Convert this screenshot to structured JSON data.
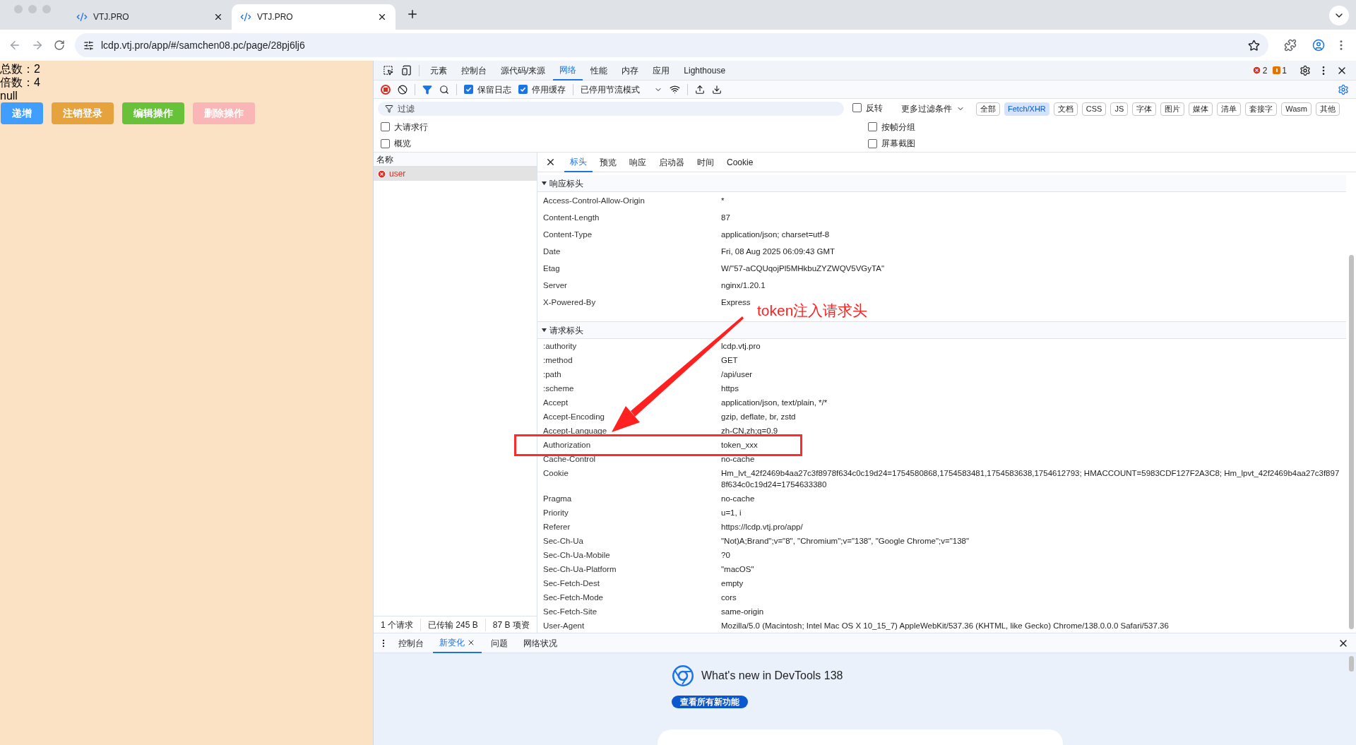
{
  "browser": {
    "tabs": [
      {
        "title": "VTJ.PRO",
        "selected": false
      },
      {
        "title": "VTJ.PRO",
        "selected": true
      }
    ],
    "url": "lcdp.vtj.pro/app/#/samchen08.pc/page/28pj6lj6"
  },
  "page": {
    "lines": [
      "总数：2",
      "倍数：4",
      "null"
    ],
    "buttons": [
      {
        "label": "递增",
        "color": "#409eff"
      },
      {
        "label": "注销登录",
        "color": "#e6a23c"
      },
      {
        "label": "编辑操作",
        "color": "#67c23a"
      },
      {
        "label": "删除操作",
        "color": "#fab6b6"
      }
    ]
  },
  "devtools": {
    "panel_tabs": [
      {
        "label": "元素",
        "selected": false
      },
      {
        "label": "控制台",
        "selected": false
      },
      {
        "label": "源代码/来源",
        "selected": false
      },
      {
        "label": "网络",
        "selected": true
      },
      {
        "label": "性能",
        "selected": false
      },
      {
        "label": "内存",
        "selected": false
      },
      {
        "label": "应用",
        "selected": false
      },
      {
        "label": "Lighthouse",
        "selected": false
      }
    ],
    "error_count": "2",
    "warning_count": "1",
    "toolbar": {
      "checkboxes": [
        {
          "label": "保留日志",
          "checked": true
        },
        {
          "label": "停用缓存",
          "checked": true
        }
      ],
      "throttling": "已停用节流模式"
    },
    "filter": {
      "placeholder": "过滤",
      "invert": {
        "label": "反转",
        "checked": false
      },
      "more_filters": "更多过滤条件",
      "types": [
        {
          "label": "全部",
          "selected": false
        },
        {
          "label": "Fetch/XHR",
          "selected": true
        },
        {
          "label": "文档",
          "selected": false
        },
        {
          "label": "CSS",
          "selected": false
        },
        {
          "label": "JS",
          "selected": false
        },
        {
          "label": "字体",
          "selected": false
        },
        {
          "label": "图片",
          "selected": false
        },
        {
          "label": "媒体",
          "selected": false
        },
        {
          "label": "清单",
          "selected": false
        },
        {
          "label": "套接字",
          "selected": false
        },
        {
          "label": "Wasm",
          "selected": false
        },
        {
          "label": "其他",
          "selected": false
        }
      ]
    },
    "options": [
      {
        "label": "大请求行",
        "checked": false
      },
      {
        "label": "按帧分组",
        "checked": false
      },
      {
        "label": "概览",
        "checked": false
      },
      {
        "label": "屏幕截图",
        "checked": false
      }
    ],
    "requests": {
      "column": "名称",
      "rows": [
        {
          "name": "user",
          "error": true,
          "selected": true
        }
      ],
      "status": [
        "1 个请求",
        "已传输 245 B",
        "87 B 项资"
      ]
    },
    "details": {
      "tabs": [
        {
          "label": "标头",
          "selected": true
        },
        {
          "label": "预览",
          "selected": false
        },
        {
          "label": "响应",
          "selected": false
        },
        {
          "label": "启动器",
          "selected": false
        },
        {
          "label": "时间",
          "selected": false
        },
        {
          "label": "Cookie",
          "selected": false
        }
      ],
      "sections": [
        {
          "title": "响应标头",
          "expanded": true,
          "headers": [
            {
              "name": "Access-Control-Allow-Origin",
              "value": "*"
            },
            {
              "name": "Content-Length",
              "value": "87"
            },
            {
              "name": "Content-Type",
              "value": "application/json; charset=utf-8"
            },
            {
              "name": "Date",
              "value": "Fri, 08 Aug 2025 06:09:43 GMT"
            },
            {
              "name": "Etag",
              "value": "W/\"57-aCQUqojPl5MHkbuZYZWQV5VGyTA\""
            },
            {
              "name": "Server",
              "value": "nginx/1.20.1"
            },
            {
              "name": "X-Powered-By",
              "value": "Express"
            }
          ]
        },
        {
          "title": "请求标头",
          "expanded": true,
          "headers": [
            {
              "name": ":authority",
              "value": "lcdp.vtj.pro"
            },
            {
              "name": ":method",
              "value": "GET"
            },
            {
              "name": ":path",
              "value": "/api/user"
            },
            {
              "name": ":scheme",
              "value": "https"
            },
            {
              "name": "Accept",
              "value": "application/json, text/plain, */*"
            },
            {
              "name": "Accept-Encoding",
              "value": "gzip, deflate, br, zstd"
            },
            {
              "name": "Accept-Language",
              "value": "zh-CN,zh;q=0.9"
            },
            {
              "name": "Authorization",
              "value": "token_xxx",
              "highlighted": true
            },
            {
              "name": "Cache-Control",
              "value": "no-cache"
            },
            {
              "name": "Cookie",
              "value": "Hm_lvt_42f2469b4aa27c3f8978f634c0c19d24=1754580868,1754583481,1754583638,1754612793; HMACCOUNT=5983CDF127F2A3C8; Hm_lpvt_42f2469b4aa27c3f8978f634c0c19d24=1754633380"
            },
            {
              "name": "Pragma",
              "value": "no-cache"
            },
            {
              "name": "Priority",
              "value": "u=1, i"
            },
            {
              "name": "Referer",
              "value": "https://lcdp.vtj.pro/app/"
            },
            {
              "name": "Sec-Ch-Ua",
              "value": "\"Not)A;Brand\";v=\"8\", \"Chromium\";v=\"138\", \"Google Chrome\";v=\"138\""
            },
            {
              "name": "Sec-Ch-Ua-Mobile",
              "value": "?0"
            },
            {
              "name": "Sec-Ch-Ua-Platform",
              "value": "\"macOS\""
            },
            {
              "name": "Sec-Fetch-Dest",
              "value": "empty"
            },
            {
              "name": "Sec-Fetch-Mode",
              "value": "cors"
            },
            {
              "name": "Sec-Fetch-Site",
              "value": "same-origin"
            },
            {
              "name": "User-Agent",
              "value": "Mozilla/5.0 (Macintosh; Intel Mac OS X 10_15_7) AppleWebKit/537.36 (KHTML, like Gecko) Chrome/138.0.0.0 Safari/537.36"
            }
          ]
        }
      ]
    },
    "annotation": {
      "text": "token注入请求头"
    },
    "drawer": {
      "tabs": [
        {
          "label": "控制台",
          "selected": false,
          "closable": false
        },
        {
          "label": "新变化",
          "selected": true,
          "closable": true
        },
        {
          "label": "问题",
          "selected": false,
          "closable": false
        },
        {
          "label": "网络状况",
          "selected": false,
          "closable": false
        }
      ],
      "title": "What's new in DevTools 138",
      "button": "查看所有新功能"
    }
  }
}
